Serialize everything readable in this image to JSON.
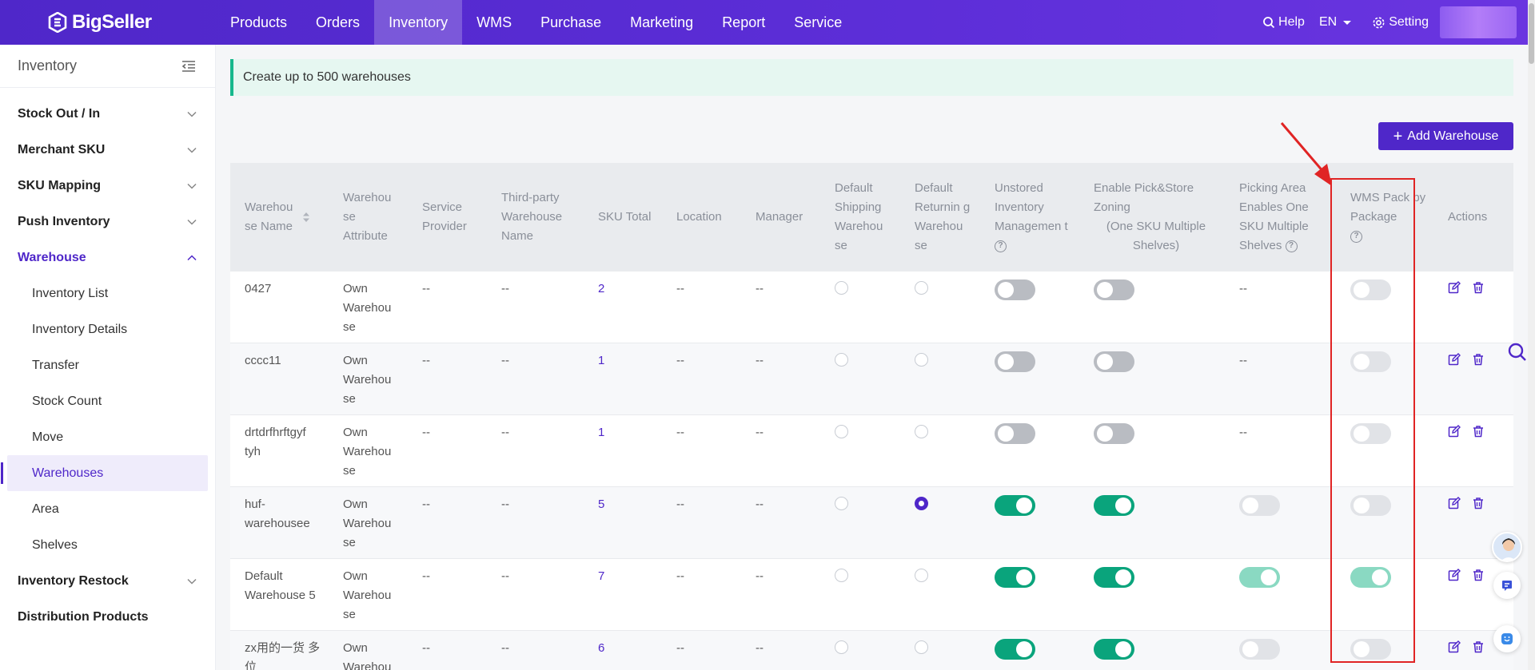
{
  "app": {
    "logo_text": "BigSeller"
  },
  "nav": {
    "items": [
      "Products",
      "Orders",
      "Inventory",
      "WMS",
      "Purchase",
      "Marketing",
      "Report",
      "Service"
    ],
    "active_index": 2,
    "help": "Help",
    "lang": "EN",
    "setting": "Setting"
  },
  "sidebar": {
    "title": "Inventory",
    "sections": [
      {
        "label": "Stock Out / In"
      },
      {
        "label": "Merchant SKU"
      },
      {
        "label": "SKU Mapping"
      },
      {
        "label": "Push Inventory"
      },
      {
        "label": "Warehouse"
      }
    ],
    "sub_items": [
      "Inventory List",
      "Inventory Details",
      "Transfer",
      "Stock Count",
      "Move",
      "Warehouses",
      "Area",
      "Shelves"
    ],
    "active_sub": "Warehouses",
    "after_sections": [
      {
        "label": "Inventory Restock"
      },
      {
        "label": "Distribution Products"
      }
    ]
  },
  "notice": {
    "text": "Create up to 500 warehouses"
  },
  "toolbar": {
    "add_label": "Add Warehouse"
  },
  "table": {
    "headers": {
      "name": "Warehou se Name",
      "attribute": "Warehou se Attribute",
      "provider": "Service Provider",
      "third_party": "Third-party Warehouse Name",
      "sku_total": "SKU Total",
      "location": "Location",
      "manager": "Manager",
      "default_shipping": "Default Shipping Warehou se",
      "default_returning": "Default Returnin g Warehou se",
      "unstored": "Unstored Inventory Managemen t",
      "pick_store": "Enable Pick&Store Zoning",
      "pick_store_sub": "(One SKU Multiple Shelves)",
      "picking_area": "Picking Area Enables One SKU Multiple Shelves",
      "wms_pack": "WMS Pack by Package",
      "actions": "Actions"
    },
    "rows": [
      {
        "name": "0427",
        "attribute": "Own Warehou se",
        "provider": "--",
        "third_party": "--",
        "sku_total": "2",
        "location": "--",
        "manager": "--",
        "default_shipping": false,
        "default_returning": false,
        "unstored": "off",
        "pick_store": "off",
        "picking_area": "--",
        "wms_pack": "light"
      },
      {
        "name": "cccc11",
        "attribute": "Own Warehou se",
        "provider": "--",
        "third_party": "--",
        "sku_total": "1",
        "location": "--",
        "manager": "--",
        "default_shipping": false,
        "default_returning": false,
        "unstored": "off",
        "pick_store": "off",
        "picking_area": "--",
        "wms_pack": "light"
      },
      {
        "name": "drtdrfhrftgyf tyh",
        "attribute": "Own Warehou se",
        "provider": "--",
        "third_party": "--",
        "sku_total": "1",
        "location": "--",
        "manager": "--",
        "default_shipping": false,
        "default_returning": false,
        "unstored": "off",
        "pick_store": "off",
        "picking_area": "--",
        "wms_pack": "light"
      },
      {
        "name": "huf-warehousee",
        "attribute": "Own Warehou se",
        "provider": "--",
        "third_party": "--",
        "sku_total": "5",
        "location": "--",
        "manager": "--",
        "default_shipping": false,
        "default_returning": true,
        "unstored": "on",
        "pick_store": "on",
        "picking_area": "light",
        "wms_pack": "light"
      },
      {
        "name": "Default Warehouse 5",
        "attribute": "Own Warehou se",
        "provider": "--",
        "third_party": "--",
        "sku_total": "7",
        "location": "--",
        "manager": "--",
        "default_shipping": false,
        "default_returning": false,
        "unstored": "on",
        "pick_store": "on",
        "picking_area": "light-on",
        "wms_pack": "light-on"
      },
      {
        "name": "zx用的一货 多位",
        "attribute": "Own Warehou",
        "provider": "--",
        "third_party": "--",
        "sku_total": "6",
        "location": "--",
        "manager": "--",
        "default_shipping": false,
        "default_returning": false,
        "unstored": "on",
        "pick_store": "on",
        "picking_area": "light",
        "wms_pack": "light"
      }
    ]
  },
  "colors": {
    "brand": "#4f27c9",
    "toggle_on": "#0aa47c",
    "highlight": "#e02424"
  }
}
